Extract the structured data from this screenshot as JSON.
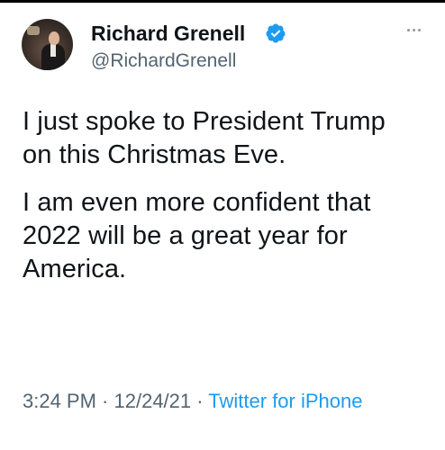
{
  "author": {
    "display_name": "Richard Grenell",
    "handle": "@RichardGrenell",
    "verified": true
  },
  "tweet": {
    "paragraphs": [
      "I just spoke to President Trump on this Christmas Eve.",
      "I am even more confident that 2022 will be a great year for America."
    ]
  },
  "meta": {
    "time": "3:24 PM",
    "separator": " · ",
    "date": "12/24/21",
    "source": "Twitter for iPhone"
  },
  "icons": {
    "verified": "verified-badge-icon",
    "more": "more-options-icon"
  },
  "colors": {
    "verified_blue": "#1d9bf0",
    "secondary_text": "#536471",
    "primary_text": "#0f1419",
    "link": "#1d9bf0"
  }
}
